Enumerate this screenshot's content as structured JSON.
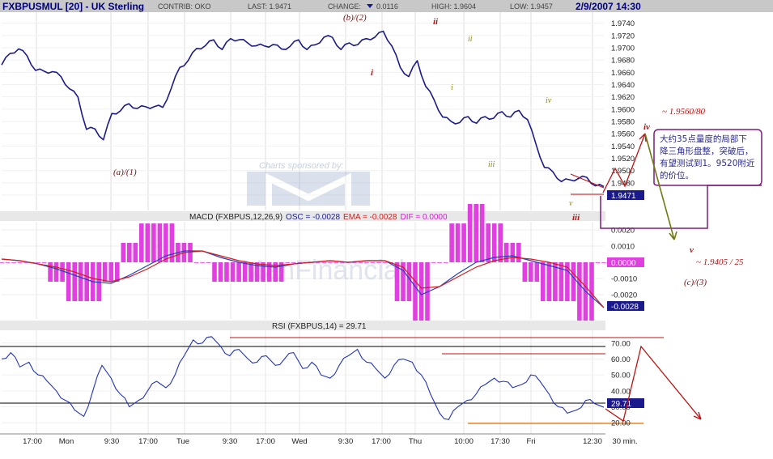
{
  "header": {
    "symbol": "FXBPUSMUL [20] - UK Sterling",
    "contrib": "CONTRIB: OKO",
    "last": "LAST: 1.9471",
    "change_label": "CHANGE:",
    "change_value": "0.0116",
    "high": "HIGH: 1.9604",
    "low": "LOW: 1.9457",
    "datetime": "2/9/2007 14:30"
  },
  "colors": {
    "header_bg": "#c8c8c8",
    "price_line": "#1a1a8c",
    "macd_line": "#1f3fbf",
    "signal_line": "#d41c1c",
    "histogram": "#e040e0",
    "annotation_red": "#c01010",
    "annotation_olive": "#8c8c20",
    "callout_border": "#7a1f7a",
    "rsi_line": "#2233bb",
    "orange_line": "#f0801e"
  },
  "panels": {
    "price": {
      "watermark": "Charts sponsored by:",
      "last_badge": "1.9471"
    },
    "macd": {
      "title_prefix": "MACD (FXBPUS,12,26,9)",
      "osc": "OSC = -0.0028",
      "ema": "EMA = -0.0028",
      "dif": "DIF = 0.0000",
      "badge_dif": "0.0000",
      "badge_osc": "-0.0028",
      "watermark": "ManFinancial"
    },
    "rsi": {
      "title": "RSI (FXBPUS,14) = 29.71",
      "badge": "29.71"
    }
  },
  "chart_data": [
    {
      "type": "line",
      "title": "FXBPUSMUL [20] - UK Sterling",
      "ylim": [
        1.9435,
        1.9758
      ],
      "y_ticks": [
        "1.9740",
        "1.9720",
        "1.9700",
        "1.9680",
        "1.9660",
        "1.9640",
        "1.9620",
        "1.9600",
        "1.9580",
        "1.9560",
        "1.9540",
        "1.9520",
        "1.9500",
        "1.9480",
        "1.9460"
      ],
      "x_ticks": [
        "17:00",
        "Mon",
        "9:30",
        "17:00",
        "Tue",
        "9:30",
        "17:00",
        "Wed",
        "9:30",
        "17:00",
        "Thu",
        "10:00",
        "17:30",
        "Fri",
        "12:30",
        "30 min."
      ],
      "series": [
        {
          "values": [
            1.9675,
            1.9688,
            1.9701,
            1.9684,
            1.9666,
            1.9659,
            1.9664,
            1.965,
            1.9636,
            1.9617,
            1.957,
            1.9565,
            1.9553,
            1.959,
            1.96,
            1.9606,
            1.9604,
            1.9601,
            1.9607,
            1.96,
            1.9637,
            1.9665,
            1.9682,
            1.9696,
            1.9706,
            1.971,
            1.97,
            1.9712,
            1.9716,
            1.9705,
            1.9706,
            1.97,
            1.9708,
            1.9695,
            1.9705,
            1.971,
            1.97,
            1.9702,
            1.972,
            1.9714,
            1.97,
            1.9705,
            1.9708,
            1.9712,
            1.972,
            1.9724,
            1.9706,
            1.9665,
            1.9656,
            1.9676,
            1.964,
            1.9612,
            1.959,
            1.9577,
            1.9581,
            1.9585,
            1.958,
            1.9585,
            1.9588,
            1.9593,
            1.959,
            1.9595,
            1.9586,
            1.954,
            1.9508,
            1.9495,
            1.9485,
            1.9482,
            1.949,
            1.9486,
            1.9478,
            1.9471
          ]
        }
      ],
      "annotations": [
        "(a)/(1)",
        "(b)/(2)",
        "i",
        "ii",
        "iii",
        "iv",
        "v",
        "ii",
        "i",
        "iii",
        "iv",
        "v",
        "~ 1.9560/80",
        "~ 1.9405 / 25",
        "(c)/(3)",
        "大约35点量度的局部下",
        "降三角形盘整，突破后，",
        "有望测试到1。9520附近",
        "的价位。"
      ]
    },
    {
      "type": "bar",
      "title": "MACD (FXBPUS,12,26,9)",
      "ylim": [
        -0.0035,
        0.0025
      ],
      "y_ticks": [
        "0.0020",
        "0.0010",
        "0.0000",
        "-0.0010",
        "-0.0020"
      ],
      "series": [
        {
          "name": "OSC",
          "values": [
            0.0002,
            0.0001,
            -0.0001,
            -0.0004,
            -0.0008,
            -0.0012,
            -0.0013,
            -0.0008,
            -0.0002,
            0.0004,
            0.0007,
            0.0007,
            0.0003,
            0.0,
            -0.0002,
            -0.0003,
            -0.0001,
            0.0,
            0.0001,
            0.0,
            0.0001,
            0.0001,
            -0.0005,
            -0.002,
            -0.0015,
            -0.0007,
            0.0,
            0.0003,
            0.0004,
            0.0001,
            -0.0002,
            -0.0005,
            -0.0018,
            -0.0028
          ]
        },
        {
          "name": "EMA",
          "values": [
            0.0002,
            0.0001,
            -0.0001,
            -0.0003,
            -0.0006,
            -0.001,
            -0.0012,
            -0.0009,
            -0.0004,
            0.0002,
            0.0006,
            0.0007,
            0.0004,
            0.0001,
            -0.0001,
            -0.0002,
            -0.0001,
            0.0,
            0.0001,
            0.0,
            0.0001,
            0.0001,
            -0.0003,
            -0.0016,
            -0.0015,
            -0.0009,
            -0.0003,
            0.0001,
            0.0003,
            0.0002,
            0.0,
            -0.0003,
            -0.0015,
            -0.0028
          ]
        },
        {
          "name": "DIF",
          "values": [
            0.0,
            0.0,
            0.0,
            -0.0001,
            -0.0002,
            -0.0002,
            -0.0001,
            0.0001,
            0.0002,
            0.0002,
            0.0001,
            0.0,
            -0.0001,
            -0.0001,
            -0.0001,
            -0.0001,
            0.0,
            0.0,
            0.0,
            0.0,
            0.0,
            0.0,
            -0.0002,
            -0.0004,
            0.0,
            0.0002,
            0.0003,
            0.0002,
            0.0001,
            -0.0001,
            -0.0002,
            -0.0002,
            -0.0003,
            0.0
          ]
        }
      ]
    },
    {
      "type": "line",
      "title": "RSI (FXBPUS,14) = 29.71",
      "ylim": [
        13,
        78
      ],
      "y_ticks": [
        "70.00",
        "60.00",
        "50.00",
        "40.00",
        "30.00",
        "20.00"
      ],
      "reference_lines": [
        70,
        30
      ],
      "series": [
        {
          "name": "RSI",
          "values": [
            60,
            64,
            55,
            58,
            50,
            46,
            40,
            34,
            28,
            24,
            40,
            56,
            48,
            38,
            30,
            34,
            40,
            46,
            42,
            50,
            62,
            72,
            70,
            74,
            68,
            62,
            66,
            60,
            58,
            62,
            56,
            60,
            64,
            54,
            58,
            50,
            48,
            56,
            62,
            66,
            58,
            54,
            48,
            56,
            60,
            58,
            50,
            38,
            26,
            22,
            30,
            34,
            38,
            44,
            48,
            46,
            42,
            44,
            50,
            46,
            38,
            30,
            26,
            28,
            34,
            32,
            29.71
          ]
        }
      ]
    }
  ]
}
